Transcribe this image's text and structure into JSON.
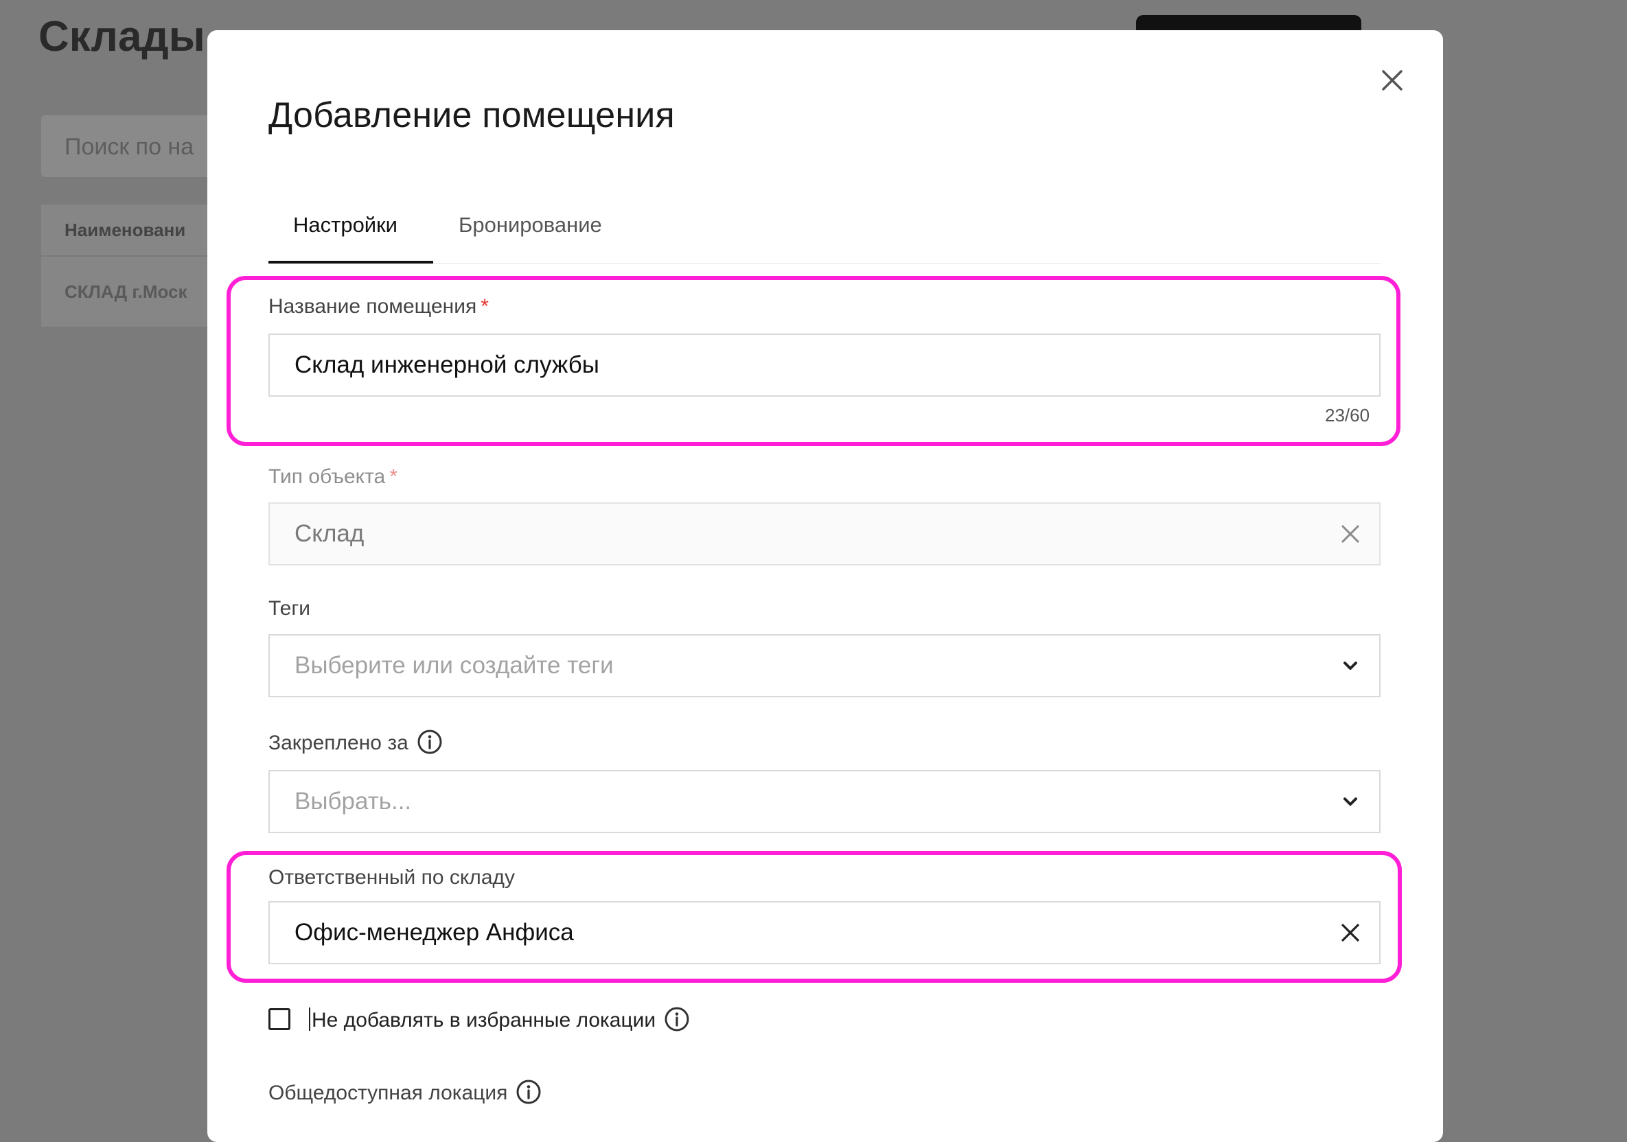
{
  "background": {
    "page_title": "Склады",
    "search_placeholder": "Поиск по на",
    "table_header": "Наименовани",
    "table_row": "СКЛАД г.Моск"
  },
  "modal": {
    "title": "Добавление помещения",
    "tabs": [
      {
        "label": "Настройки",
        "active": true
      },
      {
        "label": "Бронирование",
        "active": false
      }
    ],
    "fields": {
      "room_name": {
        "label": "Название помещения",
        "required_mark": "*",
        "value": "Склад инженерной службы",
        "counter": "23/60"
      },
      "object_type": {
        "label": "Тип объекта",
        "required_mark": "*",
        "value": "Склад",
        "disabled": true
      },
      "tags": {
        "label": "Теги",
        "placeholder": "Выберите или создайте теги"
      },
      "assigned_to": {
        "label": "Закреплено за",
        "placeholder": "Выбрать..."
      },
      "warehouse_responsible": {
        "label": "Ответственный по складу",
        "value": "Офис-менеджер Анфиса"
      }
    },
    "checkbox": {
      "label": "Не добавлять в избранные локации",
      "checked": false
    },
    "public_location": {
      "label": "Общедоступная локация"
    }
  },
  "colors": {
    "highlight": "#ff1fd6",
    "required": "#e53935",
    "overlay": "#7b7b7b"
  },
  "icons": [
    "close-icon",
    "clear-icon",
    "chevron-down-icon",
    "info-icon"
  ]
}
